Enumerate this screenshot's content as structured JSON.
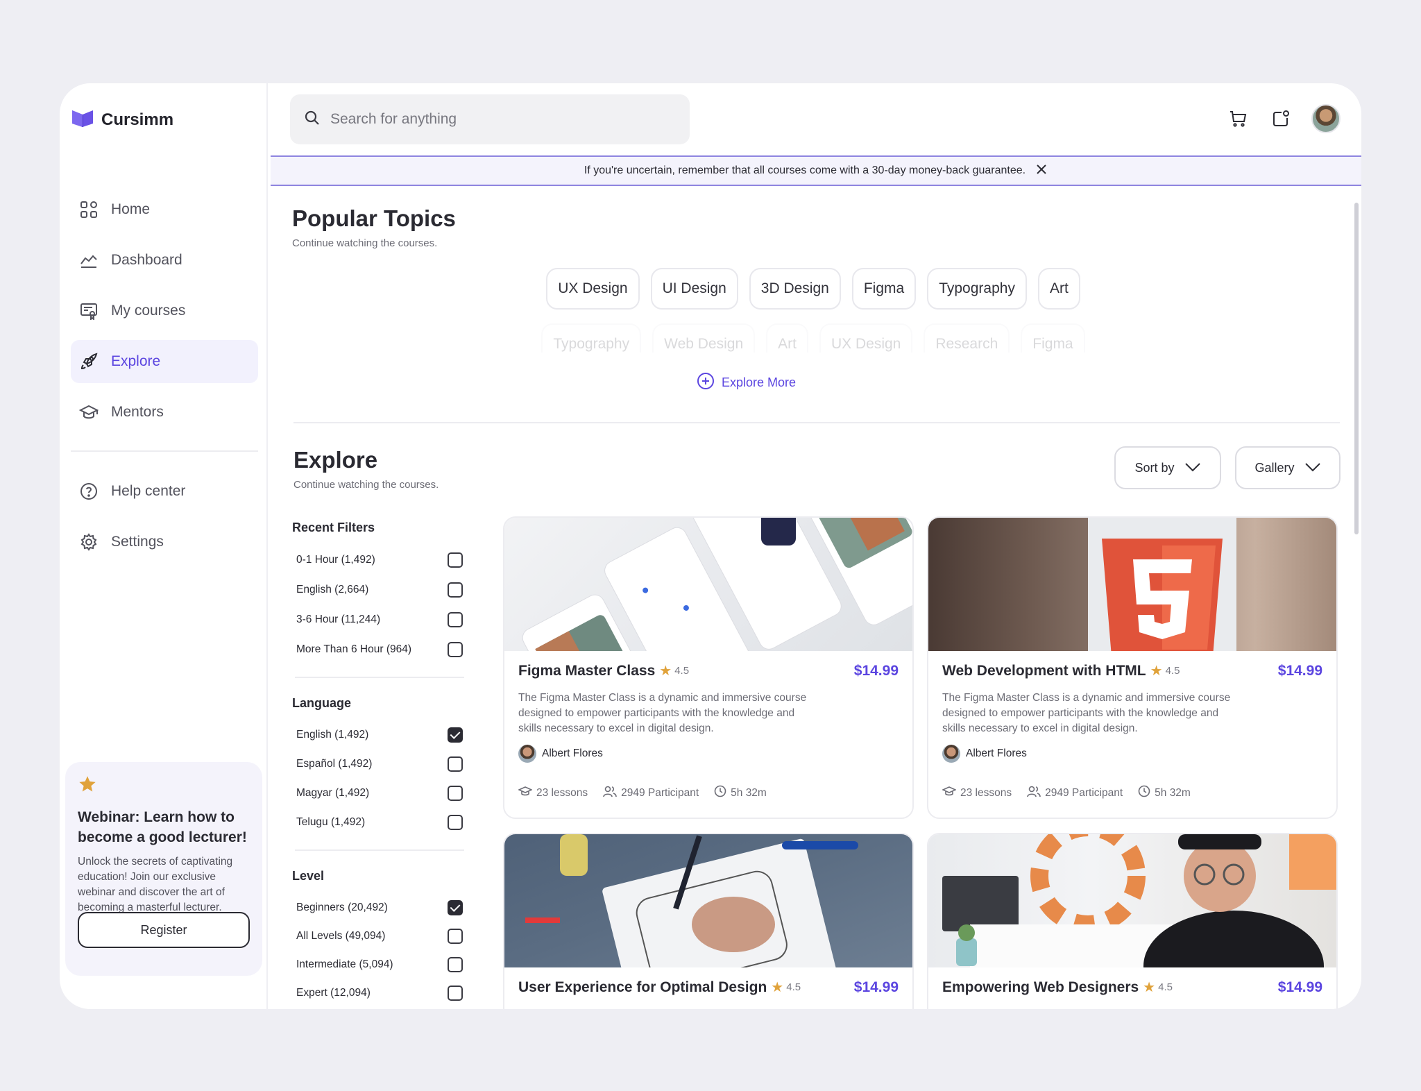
{
  "app": {
    "name": "Cursimm"
  },
  "nav": {
    "primary": [
      {
        "label": "Home",
        "icon": "grid-icon"
      },
      {
        "label": "Dashboard",
        "icon": "chart-line-icon"
      },
      {
        "label": "My courses",
        "icon": "certificate-icon"
      },
      {
        "label": "Explore",
        "icon": "rocket-icon",
        "active": true
      },
      {
        "label": "Mentors",
        "icon": "graduation-cap-icon"
      }
    ],
    "secondary": [
      {
        "label": "Help center",
        "icon": "help-circle-icon"
      },
      {
        "label": "Settings",
        "icon": "gear-icon"
      }
    ]
  },
  "webinar": {
    "title": "Webinar: Learn how to become a good lecturer!",
    "description": "Unlock the secrets of captivating education! Join our exclusive webinar and discover the art of becoming a masterful lecturer.",
    "button": "Register"
  },
  "search": {
    "placeholder": "Search for anything"
  },
  "banner": {
    "text": "If you're uncertain, remember that all courses come with a 30-day money-back guarantee."
  },
  "popular": {
    "title": "Popular Topics",
    "subtitle": "Continue watching the courses.",
    "topics": [
      "UX Design",
      "UI Design",
      "3D Design",
      "Figma",
      "Typography",
      "Art"
    ],
    "topics_more": [
      "Typography",
      "Web Design",
      "Art",
      "UX Design",
      "Research",
      "Figma"
    ],
    "explore_more": "Explore More"
  },
  "explore": {
    "title": "Explore",
    "subtitle": "Continue watching the courses.",
    "sort_label": "Sort by",
    "view_label": "Gallery"
  },
  "filters": {
    "recent": {
      "title": "Recent Filters",
      "items": [
        {
          "label": "0-1 Hour",
          "count": "(1,492)",
          "checked": false
        },
        {
          "label": "English",
          "count": "(2,664)",
          "checked": false
        },
        {
          "label": "3-6 Hour",
          "count": "(11,244)",
          "checked": false
        },
        {
          "label": "More Than 6 Hour",
          "count": "(964)",
          "checked": false
        }
      ]
    },
    "language": {
      "title": "Language",
      "items": [
        {
          "label": "English",
          "count": "(1,492)",
          "checked": true
        },
        {
          "label": "Español",
          "count": "(1,492)",
          "checked": false
        },
        {
          "label": "Magyar",
          "count": "(1,492)",
          "checked": false
        },
        {
          "label": "Telugu",
          "count": "(1,492)",
          "checked": false
        }
      ]
    },
    "level": {
      "title": "Level",
      "items": [
        {
          "label": "Beginners",
          "count": "(20,492)",
          "checked": true
        },
        {
          "label": "All Levels",
          "count": "(49,094)",
          "checked": false
        },
        {
          "label": "Intermediate",
          "count": "(5,094)",
          "checked": false
        },
        {
          "label": "Expert",
          "count": "(12,094)",
          "checked": false
        }
      ]
    }
  },
  "courses": [
    {
      "title": "Figma Master Class",
      "rating": "4.5",
      "price": "$14.99",
      "description": "The Figma Master Class is a dynamic and immersive course designed to empower participants with the knowledge and skills necessary to excel in digital design.",
      "author": "Albert Flores",
      "lessons": "23 lessons",
      "participants": "2949 Participant",
      "duration": "5h 32m"
    },
    {
      "title": "Web Development with HTML",
      "rating": "4.5",
      "price": "$14.99",
      "description": "The Figma Master Class is a dynamic and immersive course designed to empower participants with the knowledge and skills necessary to excel in digital design.",
      "author": "Albert Flores",
      "lessons": "23 lessons",
      "participants": "2949 Participant",
      "duration": "5h 32m"
    },
    {
      "title": "User Experience for Optimal Design",
      "rating": "4.5",
      "price": "$14.99"
    },
    {
      "title": "Empowering Web Designers",
      "rating": "4.5",
      "price": "$14.99"
    }
  ],
  "colors": {
    "accent": "#5b45e0",
    "star": "#e0a23a",
    "banner_bg": "#f4f3fc"
  }
}
